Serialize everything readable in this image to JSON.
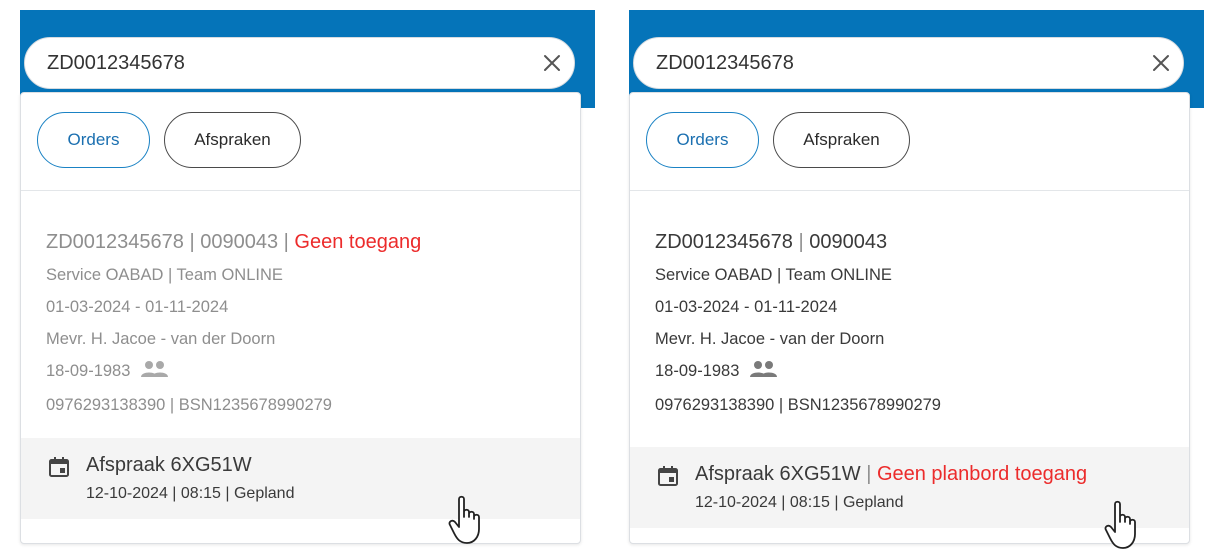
{
  "panels": [
    {
      "search": {
        "value": "ZD0012345678"
      },
      "filters": {
        "orders_label": "Orders",
        "afspraken_label": "Afspraken"
      },
      "order": {
        "id": "ZD0012345678",
        "number": "0090043",
        "access_warning": "Geen toegang",
        "service": "Service OABAD | Team ONLINE",
        "period": "01-03-2024 - 01-11-2024",
        "client": "Mevr. H. Jacoe - van der Doorn",
        "birthdate": "18-09-1983",
        "identifiers": "0976293138390 | BSN1235678990279"
      },
      "appointment": {
        "title": "Afspraak 6XG51W",
        "meta": "12-10-2024 | 08:15 | Gepland"
      }
    },
    {
      "search": {
        "value": "ZD0012345678"
      },
      "filters": {
        "orders_label": "Orders",
        "afspraken_label": "Afspraken"
      },
      "order": {
        "id": "ZD0012345678",
        "number": "0090043",
        "service": "Service OABAD | Team ONLINE",
        "period": "01-03-2024 - 01-11-2024",
        "client": "Mevr. H. Jacoe - van der Doorn",
        "birthdate": "18-09-1983",
        "identifiers": "0976293138390 | BSN1235678990279"
      },
      "appointment": {
        "title": "Afspraak 6XG51W",
        "access_warning": "Geen planbord toegang",
        "meta": "12-10-2024 | 08:15 | Gepland"
      }
    }
  ],
  "icons": {
    "clear": "close-icon",
    "people": "people-icon",
    "calendar": "calendar-icon",
    "pointer": "hand-pointer-icon"
  },
  "colors": {
    "header_blue": "#0574b9",
    "warning_red": "#ec2b2b",
    "active_chip": "#1a82c4"
  }
}
